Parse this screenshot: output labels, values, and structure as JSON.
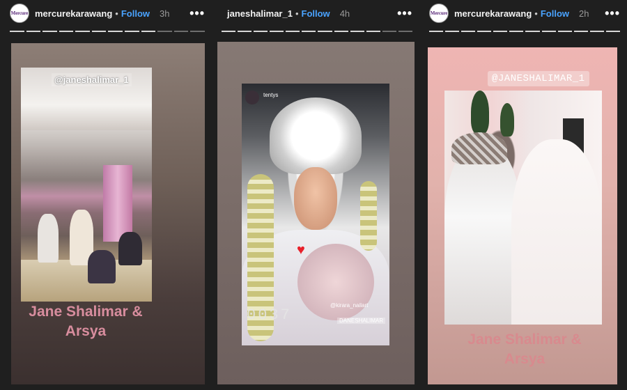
{
  "stories": [
    {
      "username": "mercurekarawang",
      "follow_label": "Follow",
      "time": "3h",
      "separator": "•",
      "more": "•••",
      "avatar_text": "Mercure",
      "progress": {
        "total": 12,
        "done": 9
      },
      "mention": "@janeshalimar_1",
      "caption_line1": "Jane Shalimar &",
      "caption_line2": "Arsya"
    },
    {
      "username": "janeshalimar_1",
      "follow_label": "Follow",
      "time": "4h",
      "separator": "•",
      "more": "•••",
      "progress": {
        "total": 12,
        "done": 10
      },
      "tag_top": "tentys",
      "counter": "0037",
      "tag_bottom": "@kirara_nailart",
      "tag_bottom2": "DANESHALIMAR",
      "heart": "♥"
    },
    {
      "username": "mercurekarawang",
      "follow_label": "Follow",
      "time": "2h",
      "separator": "•",
      "more": "•••",
      "avatar_text": "Mercure",
      "progress": {
        "total": 12,
        "done": 12
      },
      "mention": "@JANESHALIMAR_1",
      "caption_line1": "Jane Shalimar &",
      "caption_line2": "Arsya"
    }
  ],
  "colors": {
    "follow": "#4aa3ff",
    "caption": "#d88d9e",
    "background": "#1f1f1f"
  },
  "icons": {
    "more": "more-options-icon",
    "heart": "heart-icon"
  }
}
